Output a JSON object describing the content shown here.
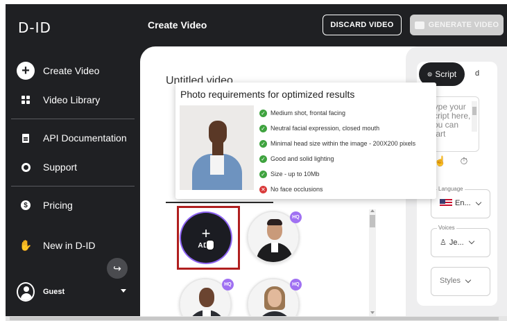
{
  "app": {
    "logo": "D-ID",
    "page_title": "Create Video"
  },
  "topbar": {
    "discard_label": "DISCARD VIDEO",
    "generate_label": "GENERATE VIDEO"
  },
  "sidebar": {
    "items": [
      {
        "label": "Create Video",
        "icon": "plus-circle-icon"
      },
      {
        "label": "Video Library",
        "icon": "grid-icon"
      },
      {
        "label": "API Documentation",
        "icon": "document-icon"
      },
      {
        "label": "Support",
        "icon": "lifebuoy-icon"
      },
      {
        "label": "Pricing",
        "icon": "dollar-icon"
      },
      {
        "label": "New in D-ID",
        "icon": "hand-icon"
      }
    ],
    "user": {
      "name": "Guest"
    }
  },
  "editor": {
    "video_title": "Untitled video",
    "add_label": "ADD",
    "hq_badge": "HQ"
  },
  "tooltip": {
    "title": "Photo requirements for optimized results",
    "requirements": [
      {
        "text": "Medium shot, frontal facing",
        "ok": true
      },
      {
        "text": "Neutral facial expression, closed mouth",
        "ok": true
      },
      {
        "text": "Minimal head size within the image - 200X200 pixels",
        "ok": true
      },
      {
        "text": "Good and solid lighting",
        "ok": true
      },
      {
        "text": "Size - up to 10Mb",
        "ok": true
      },
      {
        "text": "No face occlusions",
        "ok": false
      }
    ]
  },
  "right_panel": {
    "tab_script": "Script",
    "tab_other": "d",
    "script_placeholder": "Type your script here, you can start",
    "language_label": "Language",
    "language_value": "En...",
    "voices_label": "Voices",
    "voices_value": "Je...",
    "styles_label": "Styles"
  },
  "colors": {
    "sidebar_bg": "#1f2023",
    "accent_purple": "#a071f2",
    "highlight_red": "#b01f1f",
    "ok_green": "#3fa33f",
    "error_red": "#d93a3a"
  }
}
